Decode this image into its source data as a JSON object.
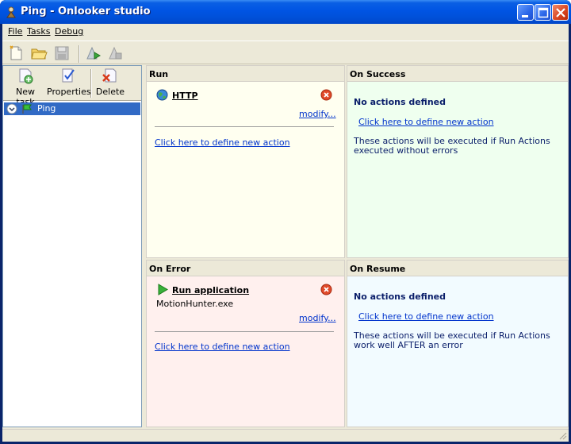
{
  "window": {
    "title": "Ping - Onlooker studio"
  },
  "menu": {
    "items": [
      "File",
      "Tasks",
      "Debug"
    ]
  },
  "toolbar": {
    "icons": [
      "new-document-icon",
      "open-folder-icon",
      "save-disk-icon",
      "run-icon",
      "stop-icon"
    ]
  },
  "task_toolbar": {
    "new_task": "New task",
    "properties": "Properties",
    "delete": "Delete"
  },
  "tree": {
    "items": [
      {
        "label": "Ping",
        "selected": true
      }
    ]
  },
  "run": {
    "header": "Run",
    "action_title": "HTTP",
    "modify": "modify...",
    "define_link": "Click here to define new action",
    "bg": "#fffff0"
  },
  "on_success": {
    "header": "On Success",
    "no_actions": "No actions defined",
    "define_link": "Click here to define new action",
    "desc": "These actions will be executed if Run Actions executed without errors",
    "bg": "#efffef"
  },
  "on_error": {
    "header": "On Error",
    "action_title": "Run application",
    "action_param": "MotionHunter.exe",
    "modify": "modify...",
    "define_link": "Click here to define new action",
    "bg": "#fff0ee"
  },
  "on_resume": {
    "header": "On Resume",
    "no_actions": "No actions defined",
    "define_link": "Click here to define new action",
    "desc": "These actions will be executed if Run Actions work well AFTER an error",
    "bg": "#f2fbff"
  },
  "colors": {
    "titlebar": "#0054e3",
    "selection": "#316ac5",
    "link": "#0033cc",
    "heading": "#0a1e6a"
  }
}
